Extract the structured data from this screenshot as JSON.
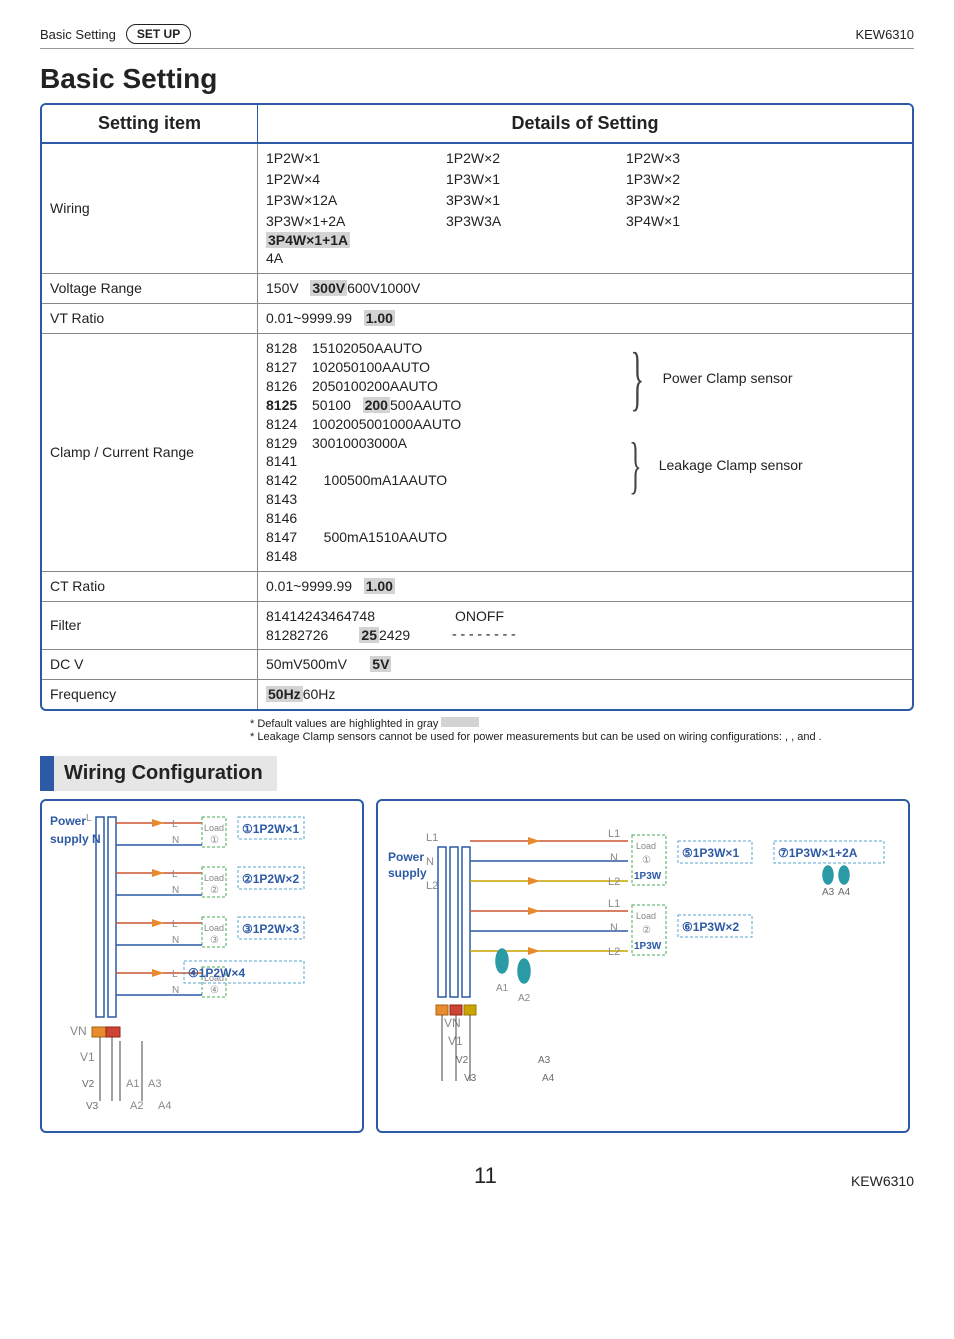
{
  "header": {
    "section": "Basic Setting",
    "pill": "SET UP",
    "model": "KEW6310"
  },
  "title": "Basic Setting",
  "table": {
    "head_item": "Setting item",
    "head_details": "Details of Setting",
    "rows": {
      "wiring": {
        "label": "Wiring",
        "grid": [
          [
            "1P2W×1",
            "1P2W×2",
            "1P2W×3"
          ],
          [
            "1P2W×4",
            "1P3W×1",
            "1P3W×2"
          ],
          [
            "1P3W×12A",
            "3P3W×1",
            "3P3W×2"
          ],
          [
            "3P3W×1+2A",
            "3P3W3A",
            "3P4W×1"
          ]
        ],
        "extra_hl": "3P4W×1+1A",
        "extra": "4A"
      },
      "voltage_range": {
        "label": "Voltage Range",
        "pre": "150V",
        "hl": "300V",
        "post": "600V1000V"
      },
      "vt_ratio": {
        "label": "VT Ratio",
        "pre": "0.01~9999.99",
        "hl": "1.00"
      },
      "clamp": {
        "label": "Clamp / Current Range",
        "list": [
          {
            "id": "8128",
            "val": "15102050AAUTO"
          },
          {
            "id": "8127",
            "val": "102050100AAUTO"
          },
          {
            "id": "8126",
            "val": "2050100200AAUTO"
          },
          {
            "id": "8125",
            "pre": "50100",
            "hl": "200",
            "post": "500AAUTO",
            "bold_id": true
          },
          {
            "id": "8124",
            "val": "1002005001000AAUTO"
          },
          {
            "id": "8129",
            "val": "30010003000A"
          },
          {
            "id": "8141",
            "val": ""
          },
          {
            "id": "8142",
            "val": "100500mA1AAUTO"
          },
          {
            "id": "8143",
            "val": ""
          },
          {
            "id": "8146",
            "val": ""
          },
          {
            "id": "8147",
            "val": "500mA1510AAUTO"
          },
          {
            "id": "8148",
            "val": ""
          }
        ],
        "brace_power": "Power Clamp sensor",
        "brace_leak": "Leakage Clamp sensor"
      },
      "ct_ratio": {
        "label": "CT Ratio",
        "pre": "0.01~9999.99",
        "hl": "1.00"
      },
      "filter": {
        "label": "Filter",
        "line1_pre": "81414243464748",
        "line1_right": "ONOFF",
        "line2_pre": "81282726",
        "line2_hl": "25",
        "line2_post": "2429",
        "line2_right": "--------"
      },
      "dcv": {
        "label": "DC V",
        "pre": "50mV500mV",
        "hl": "5V"
      },
      "freq": {
        "label": "Frequency",
        "hl": "50Hz",
        "post": "60Hz"
      }
    }
  },
  "footnotes": {
    "a": "* Default values are highlighted in gray",
    "b": "* Leakage Clamp sensors cannot be used for power measurements but can be used on wiring configurations: , ,  and ."
  },
  "section_wiring": "Wiring Configuration",
  "diagA": {
    "power": "Power",
    "supply_l": "L",
    "supply_n": "supply N",
    "load": "Load",
    "n": "N",
    "l": "L",
    "c1": "①",
    "c2": "②",
    "c3": "③",
    "c4": "④",
    "t1": "①1P2W×1",
    "t2": "②1P2W×2",
    "t3": "③1P2W×3",
    "t4": "④1P2W×4",
    "vn": "VN",
    "v1": "V1",
    "v2": "V2",
    "v3": "V3",
    "a1": "A1",
    "a2": "A2",
    "a3": "A3",
    "a4": "A4"
  },
  "diagB": {
    "power": "Power",
    "supply": "supply",
    "l1": "L1",
    "l2": "L2",
    "n": "N",
    "load": "Load",
    "c1": "①",
    "c2": "②",
    "p3w": "1P3W",
    "t5": "⑤1P3W×1",
    "t6": "⑥1P3W×2",
    "t7": "⑦1P3W×1+2A",
    "vn": "VN",
    "v1": "V1",
    "v2": "V2",
    "v3": "V3",
    "a1": "A1",
    "a2": "A2",
    "a3": "A3",
    "a4": "A4"
  },
  "footer": {
    "page": "11",
    "model": "KEW6310"
  }
}
